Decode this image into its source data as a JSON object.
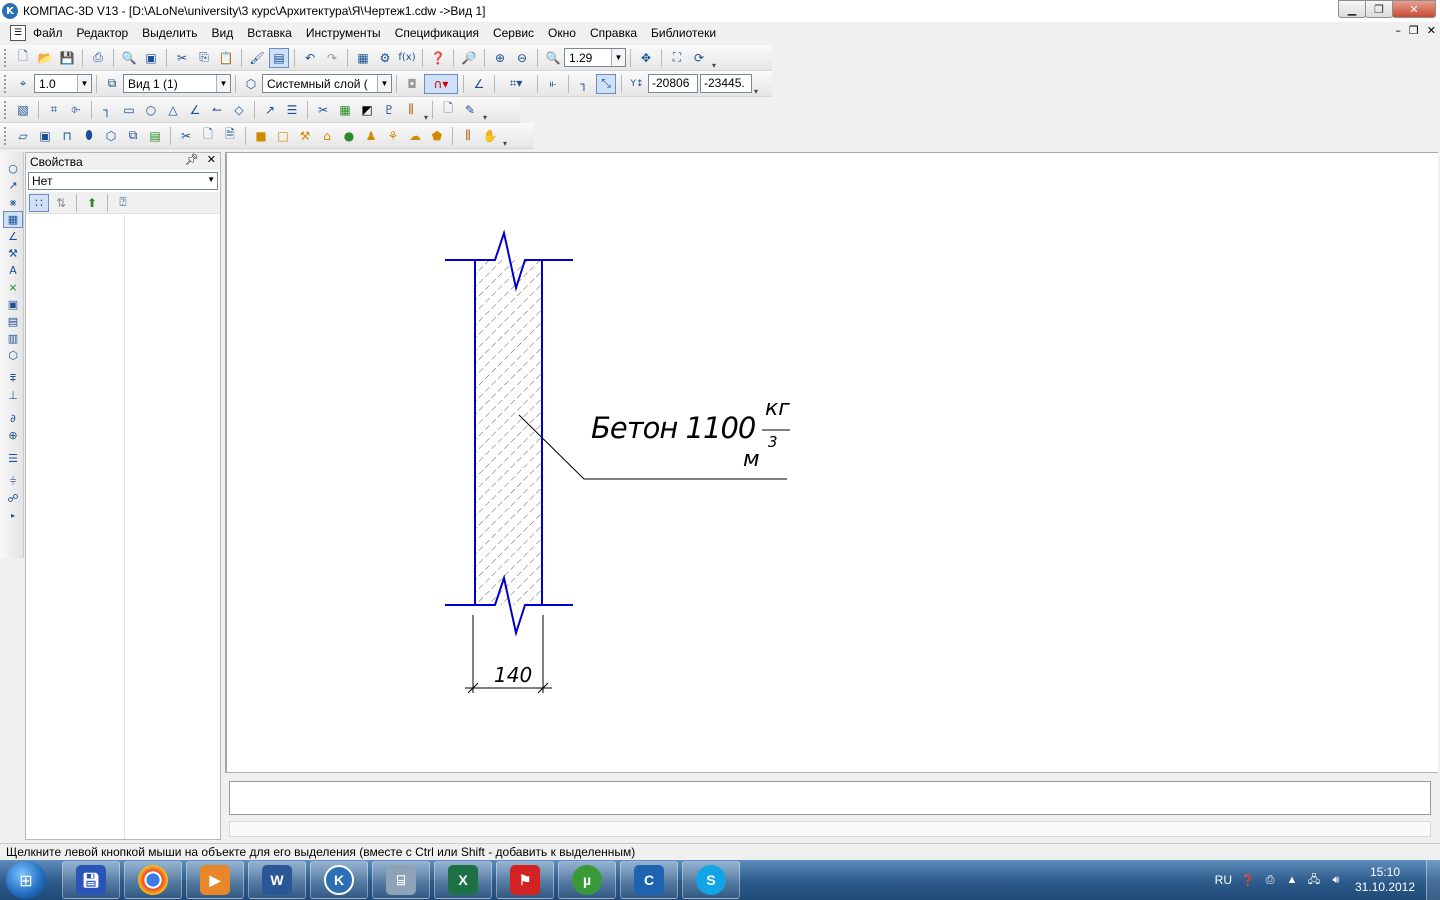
{
  "window": {
    "title": "КОМПАС-3D V13 - [D:\\ALoNe\\university\\3 курс\\Архитектура\\Я\\Чертеж1.cdw ->Вид 1]",
    "app_icon_letter": "K"
  },
  "menu": {
    "items": [
      "Файл",
      "Редактор",
      "Выделить",
      "Вид",
      "Вставка",
      "Инструменты",
      "Спецификация",
      "Сервис",
      "Окно",
      "Справка",
      "Библиотеки"
    ]
  },
  "toolbar_standard": {
    "zoom_value": "1.29"
  },
  "toolbar_current_state": {
    "step_value": "1.0",
    "view_value": "Вид 1 (1)",
    "layer_value": "Системный слой (",
    "coord_x": "-20806",
    "coord_y": "-23445."
  },
  "properties": {
    "header": "Свойства",
    "selection_value": "Нет"
  },
  "drawing": {
    "material_label": "Бетон 1100",
    "unit_numerator": "кг",
    "unit_denominator": "м",
    "unit_exponent": "3",
    "dimension_value": "140",
    "line_color": "#0000cc",
    "hatch_color": "#000000"
  },
  "statusbar": {
    "text": "Щелкните левой кнопкой мыши на объекте для его выделения (вместе с Ctrl или Shift - добавить к выделенным)"
  },
  "taskbar": {
    "tray_language": "RU",
    "clock_time": "15:10",
    "clock_date": "31.10.2012"
  }
}
